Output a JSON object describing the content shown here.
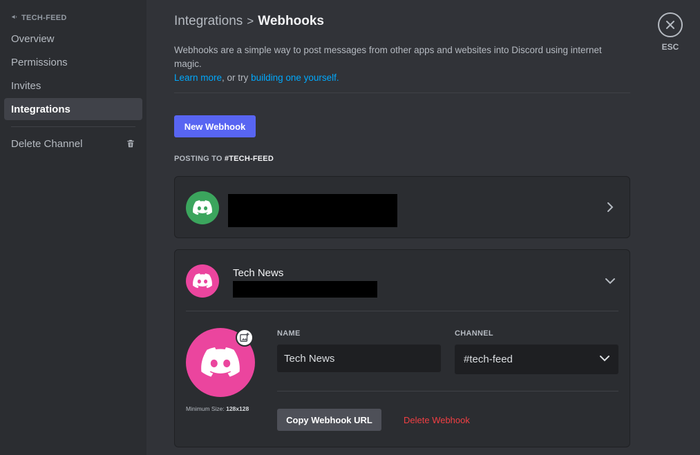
{
  "sidebar": {
    "header": "TECH-FEED",
    "header_icon": "megaphone-icon",
    "items": [
      {
        "label": "Overview"
      },
      {
        "label": "Permissions"
      },
      {
        "label": "Invites"
      },
      {
        "label": "Integrations",
        "active": true
      }
    ],
    "delete_channel": "Delete Channel"
  },
  "main": {
    "breadcrumb_parent": "Integrations",
    "breadcrumb_sep": ">",
    "breadcrumb_current": "Webhooks",
    "description": "Webhooks are a simple way to post messages from other apps and websites into Discord using internet magic.",
    "learn_more": "Learn more",
    "or_try": ", or try ",
    "build_link": "building one yourself.",
    "new_webhook": "New Webhook",
    "posting_prefix": "POSTING TO ",
    "posting_channel": "#TECH-FEED"
  },
  "webhooks": [
    {
      "name": "",
      "avatar_color": "#3ba55d",
      "expanded": false
    },
    {
      "name": "Tech News",
      "avatar_color": "#eb459e",
      "expanded": true,
      "min_size_label": "Minimum Size: ",
      "min_size_value": "128x128",
      "name_label": "NAME",
      "name_value": "Tech News",
      "channel_label": "CHANNEL",
      "channel_value": "#tech-feed",
      "copy_url": "Copy Webhook URL",
      "delete": "Delete Webhook"
    }
  ],
  "esc_label": "ESC",
  "colors": {
    "accent": "#5865f2",
    "danger": "#f23f43",
    "link": "#00a8fc"
  }
}
